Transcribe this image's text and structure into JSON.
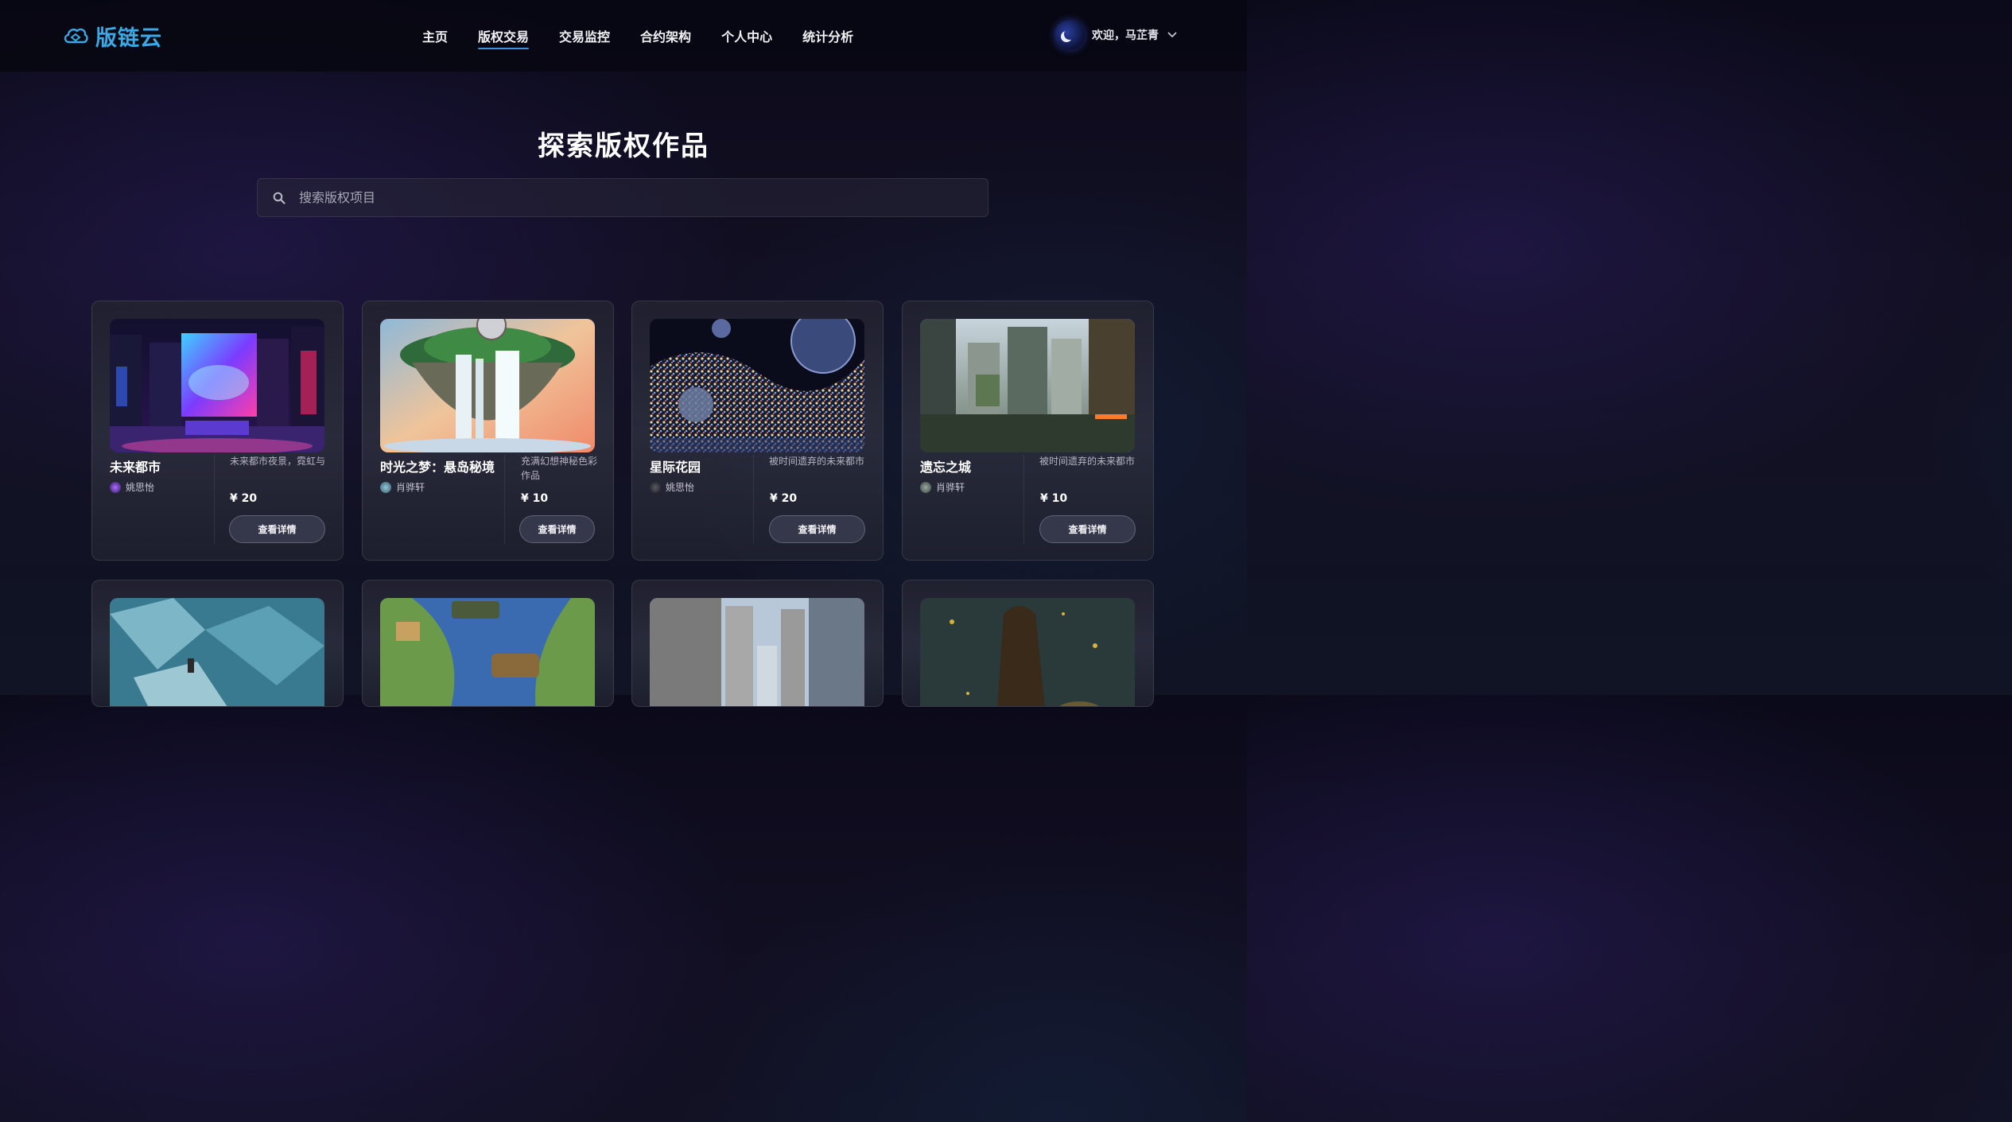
{
  "header": {
    "logo_text": "版链云",
    "nav": [
      {
        "label": "主页",
        "active": false
      },
      {
        "label": "版权交易",
        "active": true
      },
      {
        "label": "交易监控",
        "active": false
      },
      {
        "label": "合约架构",
        "active": false
      },
      {
        "label": "个人中心",
        "active": false
      },
      {
        "label": "统计分析",
        "active": false
      }
    ],
    "welcome": "欢迎，马芷青",
    "colors": {
      "accent": "#3a8fe6",
      "logo": "#3aa9e6"
    }
  },
  "main": {
    "title": "探索版权作品",
    "search_placeholder": "搜索版权项目",
    "cards": [
      {
        "title": "未来都市",
        "author": "姚思怡",
        "desc": "未来都市夜景，霓虹与",
        "price": "¥ 20",
        "button": "查看详情"
      },
      {
        "title": "时光之梦：悬岛秘境",
        "author": "肖骅轩",
        "desc": "充满幻想神秘色彩作品",
        "price": "¥ 10",
        "button": "查看详情"
      },
      {
        "title": "星际花园",
        "author": "姚思怡",
        "desc": "被时间遗弃的未来都市",
        "price": "¥ 20",
        "button": "查看详情"
      },
      {
        "title": "遗忘之城",
        "author": "肖骅轩",
        "desc": "被时间遗弃的未来都市",
        "price": "¥ 10",
        "button": "查看详情"
      }
    ]
  }
}
